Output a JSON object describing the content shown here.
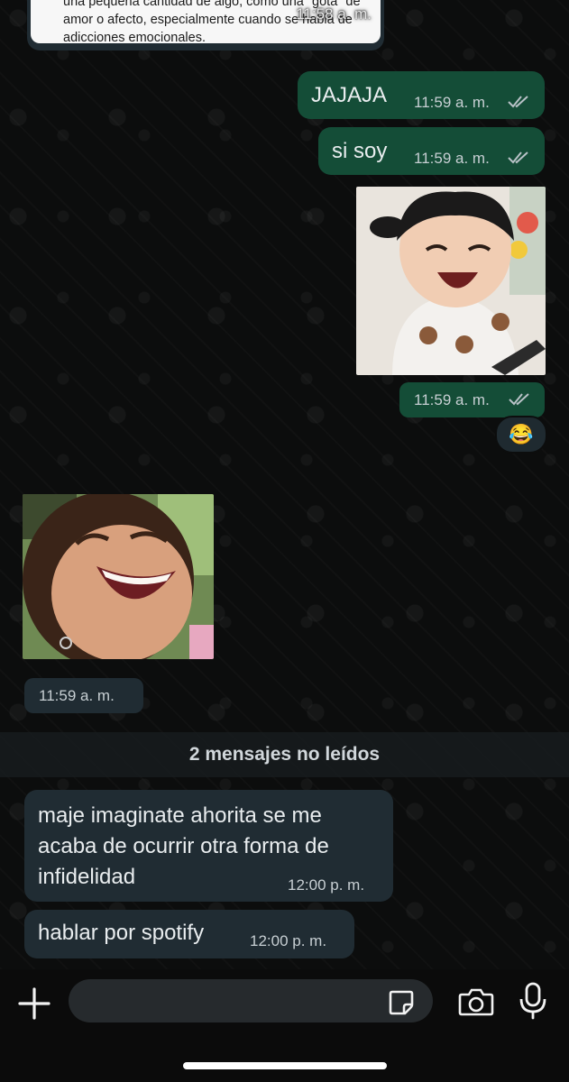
{
  "quote": {
    "text": "una pequeña cantidad de algo, como una \"gota\" de amor o afecto, especialmente cuando se habla de adicciones emocionales.",
    "time": "11:58 a. m."
  },
  "messages": [
    {
      "text": "JAJAJA",
      "time": "11:59 a. m."
    },
    {
      "text": "si soy",
      "time": "11:59 a. m."
    },
    {
      "time": "11:59 a. m."
    }
  ],
  "reaction": "😂",
  "incoming_photo": {
    "time": "11:59 a. m."
  },
  "unread_banner": "2 mensajes no leídos",
  "incoming": [
    {
      "lines": [
        "maje imaginate ahorita se me",
        "acaba de ocurrir otra forma de",
        "infidelidad"
      ],
      "time": "12:00 p. m."
    },
    {
      "text": "hablar por spotify",
      "time": "12:00 p. m."
    }
  ],
  "icons": {
    "attach": "plus-icon",
    "sticker": "sticker-icon",
    "camera": "camera-icon",
    "mic": "microphone-icon"
  },
  "colors": {
    "outgoing_bubble": "#144d37",
    "incoming_bubble": "#202c33",
    "background": "#0c0d0d"
  }
}
